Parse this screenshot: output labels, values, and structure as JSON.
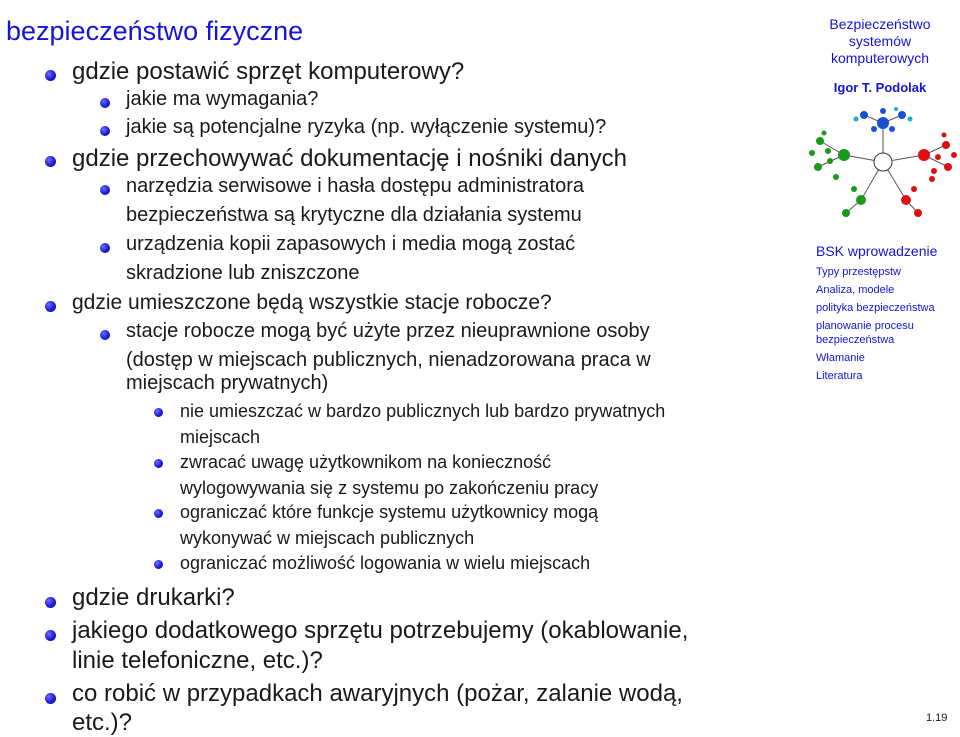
{
  "slide": {
    "title": "bezpieczeństwo fizyczne",
    "items": [
      "gdzie postawić sprzęt komputerowy?",
      "jakie ma wymagania?",
      "jakie są potencjalne ryzyka (np. wyłączenie systemu)?",
      "gdzie przechowywać dokumentację i nośniki danych",
      "narzędzia serwisowe i hasła dostępu administratora",
      "bezpieczeństwa są krytyczne dla działania systemu",
      "urządzenia kopii zapasowych i media mogą zostać",
      "skradzione lub zniszczone",
      "gdzie umieszczone będą wszystkie stacje robocze?",
      "stacje robocze mogą być użyte przez nieuprawnione osoby",
      "(dostęp w miejscach publicznych, nienadzorowana praca w",
      "miejscach prywatnych)",
      "nie umieszczać w bardzo publicznych lub bardzo prywatnych",
      "miejscach",
      "zwracać uwagę użytkownikom na konieczność",
      "wylogowywania się z systemu po zakończeniu pracy",
      "ograniczać które funkcje systemu użytkownicy mogą",
      "wykonywać w miejscach publicznych",
      "ograniczać możliwość logowania w wielu miejscach",
      "gdzie drukarki?",
      "jakiego dodatkowego sprzętu potrzebujemy (okablowanie,",
      "linie telefoniczne, etc.)?",
      "co robić w przypadkach awaryjnych (pożar, zalanie wodą,",
      "etc.)?"
    ]
  },
  "sidebar": {
    "title_line1": "Bezpieczeństwo",
    "title_line2": "systemów",
    "title_line3": "komputerowych",
    "author": "Igor T. Podolak",
    "nav": [
      "BSK wprowadzenie",
      "Typy przestępstw",
      "Analiza, modele",
      "polityka bezpieczeństwa",
      "planowanie procesu",
      "bezpieczeństwa",
      "Włamanie",
      "Literatura"
    ]
  },
  "page_number": "1.19",
  "colors": {
    "accent": "#1414d8",
    "text": "#1a1a1a",
    "tree_green": "#1a9a1a",
    "tree_red": "#e01010",
    "tree_blue": "#1a4fd0",
    "tree_cyan": "#1ab0c8"
  }
}
